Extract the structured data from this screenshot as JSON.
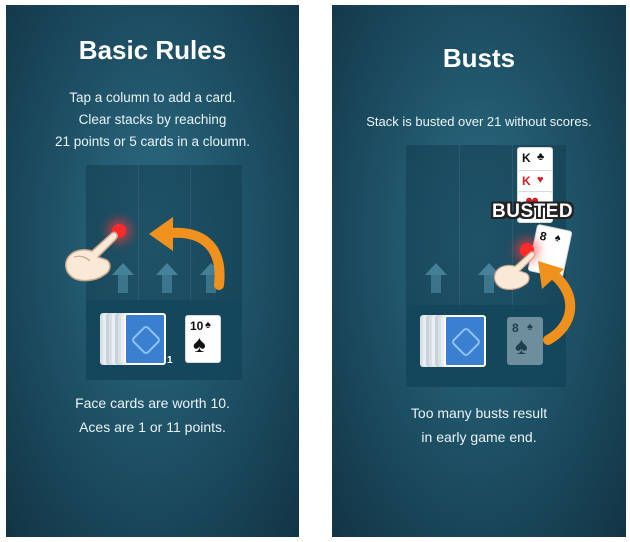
{
  "left_panel": {
    "title": "Basic Rules",
    "instruction": "Tap a column to add a card.\nClear stacks by reaching\n21 points or 5 cards in a cloumn.",
    "deck_count": "1",
    "current_card": {
      "rank": "10",
      "suit": "♠"
    },
    "footer": "Face cards are worth 10.\nAces are 1 or 11 points."
  },
  "right_panel": {
    "title": "Busts",
    "instruction": "Stack is busted over 21 without scores.",
    "stack_cards": [
      {
        "rank": "K",
        "suit": "♣"
      },
      {
        "rank": "K",
        "suit": "♥"
      },
      {
        "rank": "",
        "suit": "♥"
      }
    ],
    "busted_label": "BUSTED",
    "moving_card": {
      "rank": "8",
      "suit": "♠"
    },
    "current_card": {
      "rank": "8",
      "suit": "♠"
    },
    "footer": "Too many busts result\nin early game end."
  },
  "colors": {
    "arrow": "#f0911e",
    "tap_dot": "#ff2a2a",
    "card_back": "#3b7fd0"
  },
  "icons": [
    "tap-hand-icon",
    "curved-arrow-icon",
    "up-arrow-icon",
    "deck-logo-icon"
  ]
}
